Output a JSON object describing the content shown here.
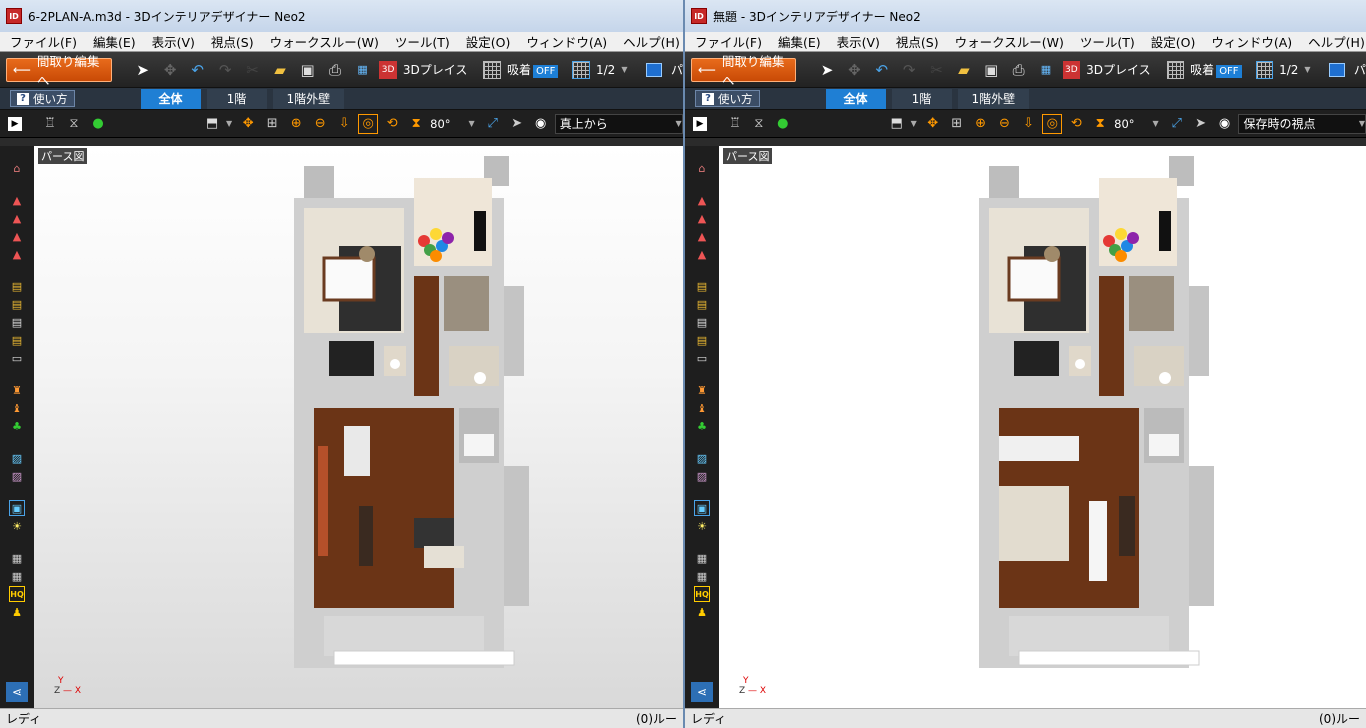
{
  "windows": [
    {
      "title": "6-2PLAN-A.m3d - 3Dインテリアデザイナー Neo2",
      "menus": [
        "ファイル(F)",
        "編集(E)",
        "表示(V)",
        "視点(S)",
        "ウォークスルー(W)",
        "ツール(T)",
        "設定(O)",
        "ウィンドウ(A)",
        "ヘルプ(H)"
      ],
      "back_button": "間取り編集へ",
      "place_3d": "3Dプレイス",
      "snap_label": "吸着",
      "snap_state": "OFF",
      "scale": "1/2",
      "extra_tb": "パ",
      "help": "使い方",
      "tabs": [
        "全体",
        "1階",
        "1階外壁"
      ],
      "fov": "80°",
      "view_mode": "真上から",
      "viewport_label": "パース図",
      "status_left": "レディ",
      "status_right": "(0)ルー"
    },
    {
      "title": "無題 - 3Dインテリアデザイナー Neo2",
      "menus": [
        "ファイル(F)",
        "編集(E)",
        "表示(V)",
        "視点(S)",
        "ウォークスルー(W)",
        "ツール(T)",
        "設定(O)",
        "ウィンドウ(A)",
        "ヘルプ(H)"
      ],
      "back_button": "間取り編集へ",
      "place_3d": "3Dプレイス",
      "snap_label": "吸着",
      "snap_state": "OFF",
      "scale": "1/2",
      "extra_tb": "パ",
      "help": "使い方",
      "tabs": [
        "全体",
        "1階",
        "1階外壁"
      ],
      "fov": "80°",
      "view_mode": "保存時の視点",
      "viewport_label": "パース図",
      "status_left": "レディ",
      "status_right": "(0)ルー"
    }
  ],
  "axis": {
    "y": "Y",
    "z": "Z",
    "x": "X"
  },
  "colors": {
    "accent": "#1f7fd4",
    "back_button": "#e86b1c",
    "wood_floor": "#6b3416",
    "wall": "#cfcfcf"
  }
}
